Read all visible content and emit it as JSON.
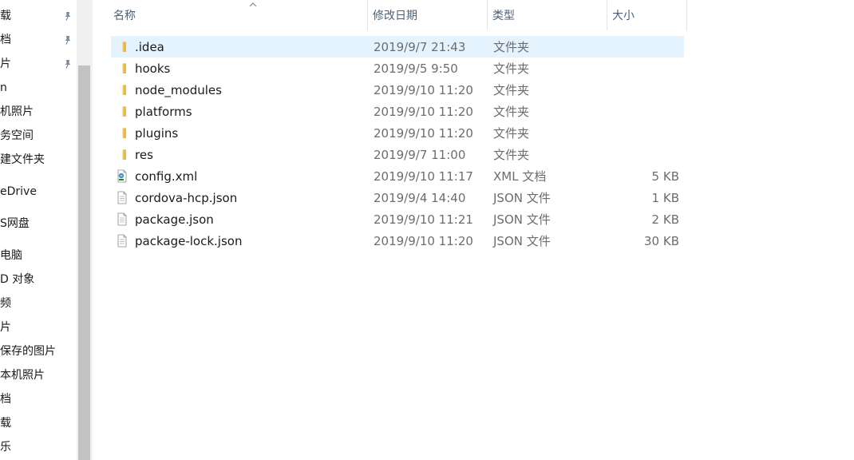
{
  "nav": {
    "items": [
      {
        "label": "载",
        "pinned": true
      },
      {
        "label": "档",
        "pinned": true
      },
      {
        "label": "片",
        "pinned": true
      },
      {
        "label": "n",
        "pinned": false
      },
      {
        "label": "机照片",
        "pinned": false
      },
      {
        "label": "务空间",
        "pinned": false
      },
      {
        "label": "建文件夹",
        "pinned": false
      },
      {
        "label": "eDrive",
        "pinned": false
      },
      {
        "label": "S网盘",
        "pinned": false
      },
      {
        "label": "电脑",
        "pinned": false
      },
      {
        "label": "D 对象",
        "pinned": false
      },
      {
        "label": "频",
        "pinned": false
      },
      {
        "label": "片",
        "pinned": false
      },
      {
        "label": "保存的图片",
        "pinned": false
      },
      {
        "label": "本机照片",
        "pinned": false
      },
      {
        "label": "档",
        "pinned": false
      },
      {
        "label": "载",
        "pinned": false
      },
      {
        "label": "乐",
        "pinned": false
      }
    ]
  },
  "columns": {
    "name": "名称",
    "date": "修改日期",
    "type": "类型",
    "size": "大小"
  },
  "files": [
    {
      "name": ".idea",
      "date": "2019/9/7 21:43",
      "type": "文件夹",
      "size": "",
      "icon": "folder-icon",
      "selected": true
    },
    {
      "name": "hooks",
      "date": "2019/9/5 9:50",
      "type": "文件夹",
      "size": "",
      "icon": "folder-icon",
      "selected": false
    },
    {
      "name": "node_modules",
      "date": "2019/9/10 11:20",
      "type": "文件夹",
      "size": "",
      "icon": "folder-icon",
      "selected": false
    },
    {
      "name": "platforms",
      "date": "2019/9/10 11:20",
      "type": "文件夹",
      "size": "",
      "icon": "folder-icon",
      "selected": false
    },
    {
      "name": "plugins",
      "date": "2019/9/10 11:20",
      "type": "文件夹",
      "size": "",
      "icon": "folder-icon",
      "selected": false
    },
    {
      "name": "res",
      "date": "2019/9/7 11:00",
      "type": "文件夹",
      "size": "",
      "icon": "folder-icon",
      "selected": false
    },
    {
      "name": "config.xml",
      "date": "2019/9/10 11:17",
      "type": "XML 文档",
      "size": "5 KB",
      "icon": "xml-file-icon",
      "selected": false
    },
    {
      "name": "cordova-hcp.json",
      "date": "2019/9/4 14:40",
      "type": "JSON 文件",
      "size": "1 KB",
      "icon": "file-icon",
      "selected": false
    },
    {
      "name": "package.json",
      "date": "2019/9/10 11:21",
      "type": "JSON 文件",
      "size": "2 KB",
      "icon": "file-icon",
      "selected": false
    },
    {
      "name": "package-lock.json",
      "date": "2019/9/10 11:20",
      "type": "JSON 文件",
      "size": "30 KB",
      "icon": "file-icon",
      "selected": false
    }
  ],
  "colors": {
    "selection": "#e5f3ff",
    "header_text": "#4c607a",
    "folder": "#f8d775",
    "scrollbar_thumb": "#c2c2c2"
  }
}
